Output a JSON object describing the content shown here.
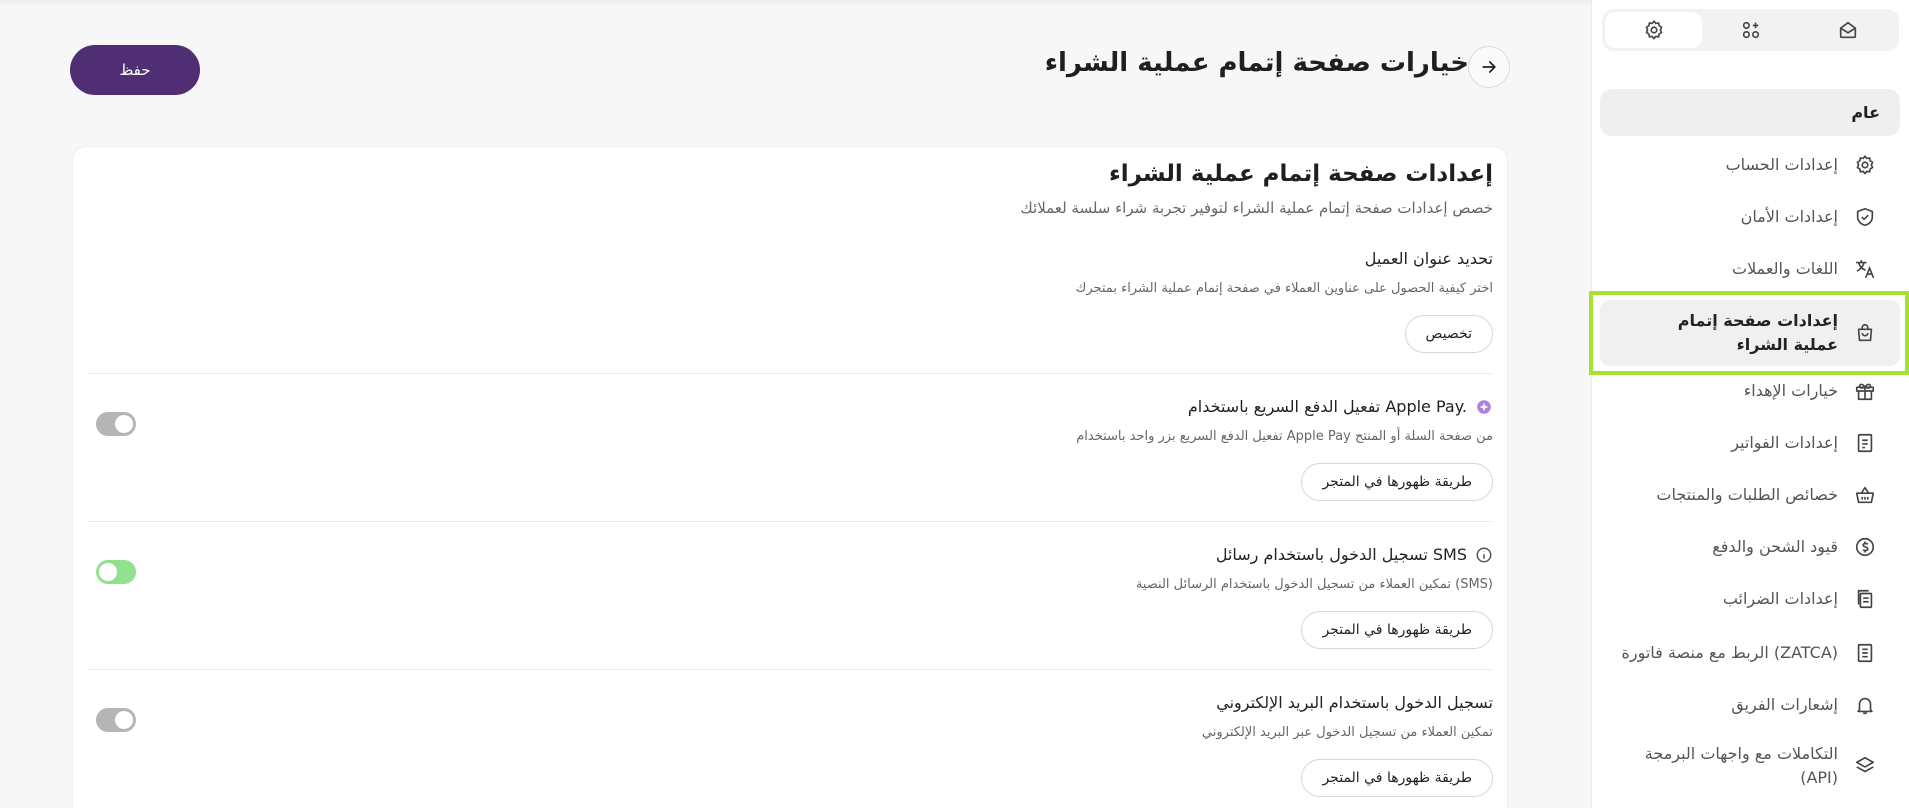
{
  "header": {
    "title": "خيارات صفحة إتمام عملية الشراء",
    "save_label": "حفظ"
  },
  "card": {
    "title": "إعدادات صفحة إتمام عملية الشراء",
    "subtitle": "خصص إعدادات صفحة إتمام عملية الشراء لتوفير تجربة شراء سلسة لعملائك"
  },
  "settings": [
    {
      "title": "تحديد عنوان العميل",
      "description": "اختر كيفية الحصول على عناوين العملاء في صفحة إتمام عملية الشراء بمتجرك",
      "button": "تخصيص"
    },
    {
      "title": "تفعيل الدفع السريع باستخدام Apple Pay.",
      "description": "تفعيل الدفع السريع بزر واحد باستخدام Apple Pay من صفحة السلة أو المنتج",
      "button": "طريقة ظهورها في المتجر",
      "toggle": "off"
    },
    {
      "title": "تسجيل الدخول باستخدام رسائل SMS",
      "description": "تمكين العملاء من تسجيل الدخول باستخدام الرسائل النصية (SMS)",
      "button": "طريقة ظهورها في المتجر",
      "toggle": "on"
    },
    {
      "title": "تسجيل الدخول باستخدام البريد الإلكتروني",
      "description": "تمكين العملاء من تسجيل الدخول عبر البريد الإلكتروني",
      "button": "طريقة ظهورها في المتجر",
      "toggle": "off"
    }
  ],
  "sidebar": {
    "tabs": [
      "home-icon",
      "apps-icon",
      "gear-icon"
    ],
    "active_tab": "gear-icon",
    "section_label": "عام",
    "items": [
      {
        "label": "إعدادات الحساب",
        "icon": "gear-icon"
      },
      {
        "label": "إعدادات الأمان",
        "icon": "shield-icon"
      },
      {
        "label": "اللغات والعملات",
        "icon": "translate-icon"
      },
      {
        "label": "إعدادات صفحة إتمام عملية الشراء",
        "icon": "bag-icon",
        "selected": true
      },
      {
        "label": "خيارات الإهداء",
        "icon": "gift-icon"
      },
      {
        "label": "إعدادات الفواتير",
        "icon": "invoice-icon"
      },
      {
        "label": "خصائص الطلبات والمنتجات",
        "icon": "basket-icon"
      },
      {
        "label": "قيود الشحن والدفع",
        "icon": "coin-icon"
      },
      {
        "label": "إعدادات الضرائب",
        "icon": "tax-icon"
      },
      {
        "label": "الربط مع منصة فاتورة (ZATCA)",
        "icon": "document-icon"
      },
      {
        "label": "إشعارات الفريق",
        "icon": "bell-icon"
      },
      {
        "label": "التكاملات مع واجهات البرمجة (API)",
        "icon": "layers-icon"
      }
    ]
  },
  "colors": {
    "primary": "#4f2e73",
    "toggle_on": "#93e08f",
    "toggle_off": "#b5b5b5",
    "highlight": "#a6e22e"
  }
}
